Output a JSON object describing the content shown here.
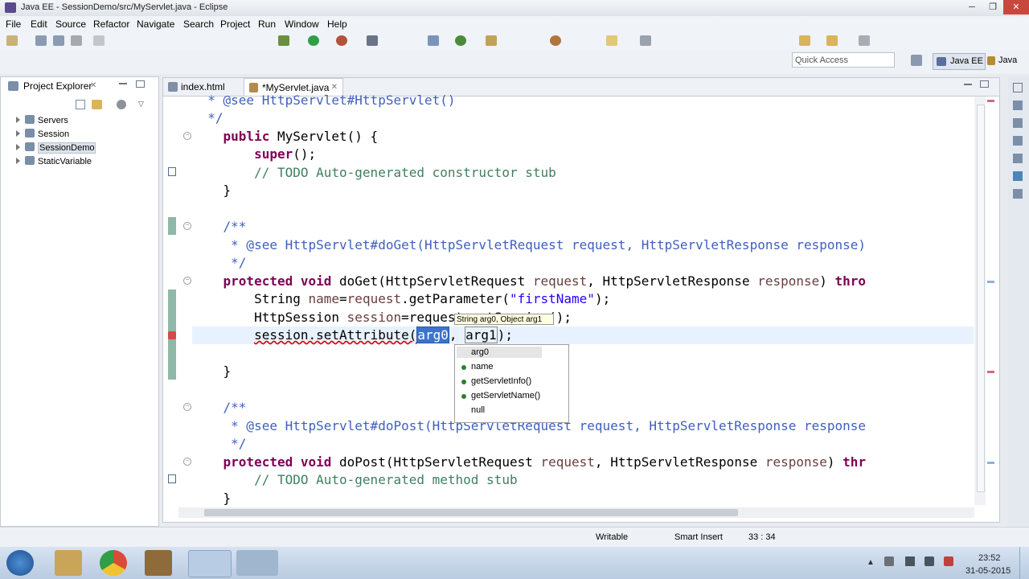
{
  "window": {
    "title": "Java EE - SessionDemo/src/MyServlet.java - Eclipse",
    "controls": [
      "─",
      "❐",
      "✕"
    ]
  },
  "menu": [
    "File",
    "Edit",
    "Source",
    "Refactor",
    "Navigate",
    "Search",
    "Project",
    "Run",
    "Window",
    "Help"
  ],
  "quick_access": {
    "placeholder": "Quick Access"
  },
  "perspectives": [
    {
      "label": "Java EE",
      "active": true
    },
    {
      "label": "Java",
      "active": false
    }
  ],
  "project_explorer": {
    "title": "Project Explorer",
    "projects": [
      "Servers",
      "Session",
      "SessionDemo",
      "StaticVariable"
    ],
    "selected": "SessionDemo"
  },
  "editor": {
    "tabs": [
      {
        "label": "index.html",
        "active": false
      },
      {
        "label": "*MyServlet.java",
        "active": true
      }
    ],
    "lines": [
      "  * @see HttpServlet#HttpServlet()",
      "  */",
      "public MyServlet() {",
      "    super();",
      "    // TODO Auto-generated constructor stub",
      "}",
      "",
      "/**",
      " * @see HttpServlet#doGet(HttpServletRequest request, HttpServletResponse response)",
      " */",
      "protected void doGet(HttpServletRequest request, HttpServletResponse response) thro",
      "    String name=request.getParameter(\"firstName\");",
      "    HttpSession session=request.getSession();",
      "    session.setAttribute(arg0, arg1);",
      "",
      "}",
      "",
      "/**",
      " * @see HttpServlet#doPost(HttpServletRequest request, HttpServletResponse response",
      " */",
      "protected void doPost(HttpServletRequest request, HttpServletResponse response) thr",
      "    // TODO Auto-generated method stub",
      "}"
    ]
  },
  "content_assist": {
    "tooltip": "String arg0, Object arg1",
    "items": [
      "arg0",
      "name",
      "getServletInfo()",
      "getServletName()",
      "null"
    ]
  },
  "status": {
    "writable": "Writable",
    "insert_mode": "Smart Insert",
    "position": "33 : 34"
  },
  "taskbar": {
    "time": "23:52",
    "date": "31-05-2015"
  }
}
